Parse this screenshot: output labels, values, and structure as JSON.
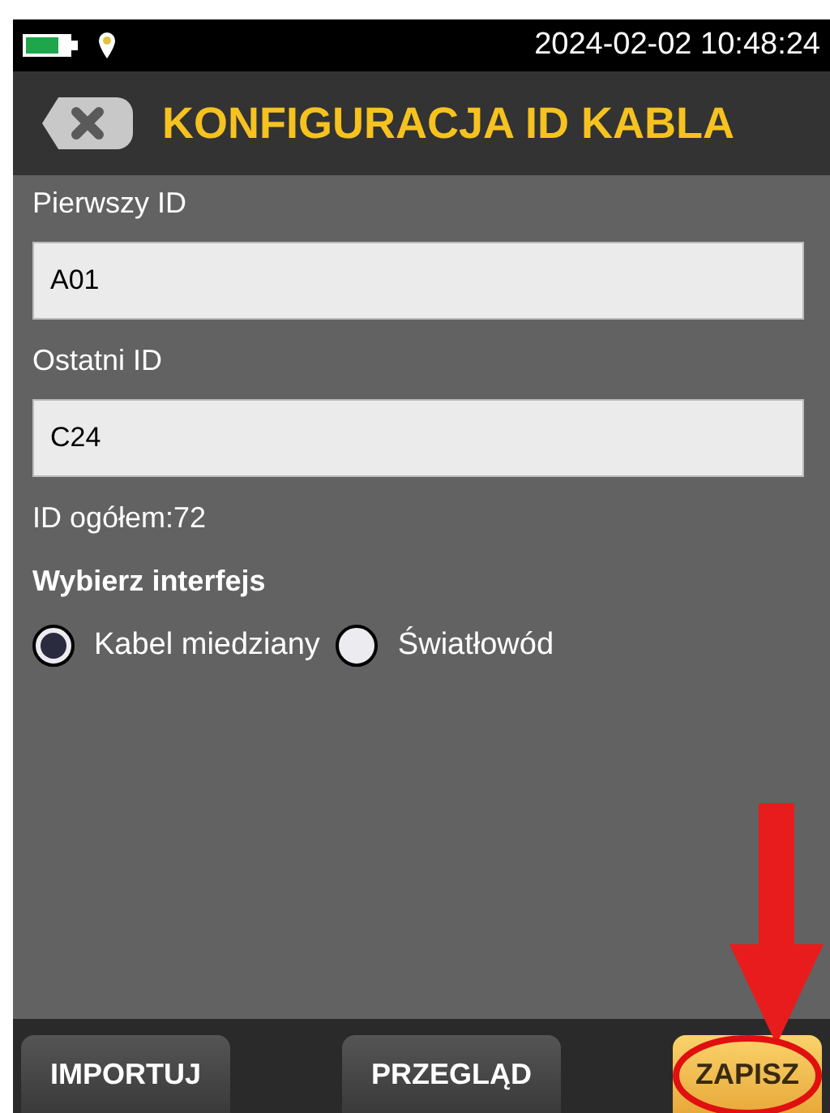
{
  "status_bar": {
    "datetime": "2024-02-02 10:48:24"
  },
  "header": {
    "title": "KONFIGURACJA ID KABLA"
  },
  "fields": [
    {
      "label": "Pierwszy ID",
      "value": "A01"
    },
    {
      "label": "Ostatni ID",
      "value": "C24"
    }
  ],
  "total": "ID ogółem:72",
  "interface": {
    "title": "Wybierz interfejs",
    "options": [
      {
        "label": "Kabel miedziany",
        "selected": true
      },
      {
        "label": "Światłowód",
        "selected": false
      }
    ]
  },
  "buttons": [
    {
      "label": "IMPORTUJ",
      "kind": "dark"
    },
    {
      "label": "PRZEGLĄD",
      "kind": "dark"
    },
    {
      "label": "ZAPISZ",
      "kind": "primary"
    }
  ],
  "annotations": [
    {
      "kind": "arrow"
    },
    {
      "kind": "ellipse"
    }
  ]
}
